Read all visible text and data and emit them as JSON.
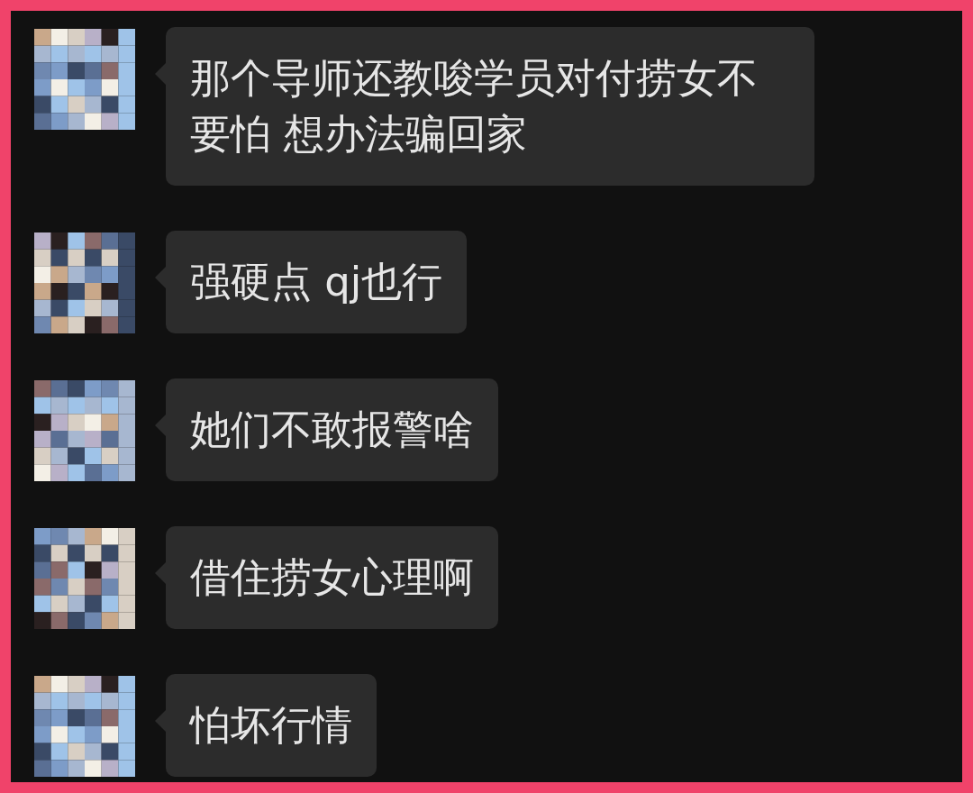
{
  "messages": [
    {
      "text": "那个导师还教唆学员对付捞女不要怕 想办法骗回家"
    },
    {
      "text": "强硬点 qj也行"
    },
    {
      "text": "她们不敢报警啥"
    },
    {
      "text": "借住捞女心理啊"
    },
    {
      "text": "怕坏行情"
    }
  ]
}
